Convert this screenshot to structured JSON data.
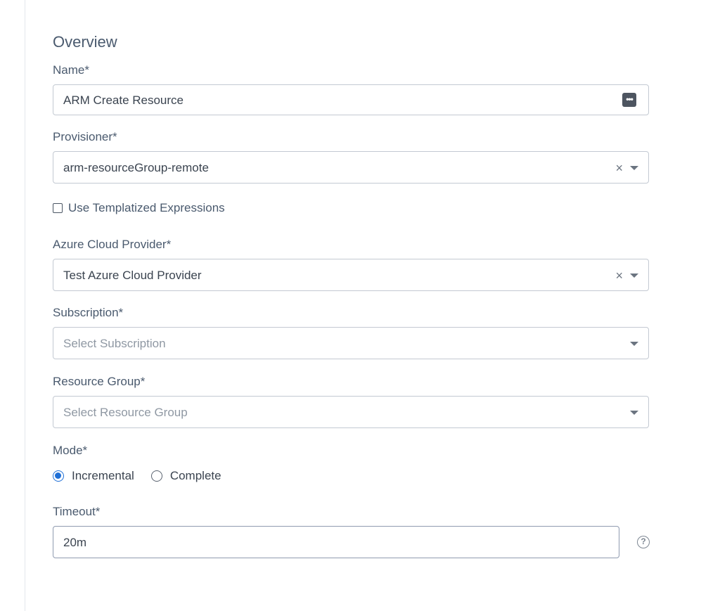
{
  "section": {
    "title": "Overview"
  },
  "name": {
    "label": "Name*",
    "value": "ARM Create Resource",
    "variables_icon": "more-horizontal-icon"
  },
  "provisioner": {
    "label": "Provisioner*",
    "value": "arm-resourceGroup-remote",
    "clear_glyph": "×"
  },
  "templatized": {
    "label": "Use Templatized Expressions",
    "checked": false
  },
  "cloud_provider": {
    "label": "Azure Cloud Provider*",
    "value": "Test Azure Cloud Provider",
    "clear_glyph": "×"
  },
  "subscription": {
    "label": "Subscription*",
    "placeholder": "Select Subscription"
  },
  "resource_group": {
    "label": "Resource Group*",
    "placeholder": "Select Resource Group"
  },
  "mode": {
    "label": "Mode*",
    "options": [
      {
        "label": "Incremental",
        "selected": true
      },
      {
        "label": "Complete",
        "selected": false
      }
    ]
  },
  "timeout": {
    "label": "Timeout*",
    "value": "20m",
    "help_glyph": "?"
  },
  "colors": {
    "accent": "#1f6fd6",
    "label_text": "#4a5a6e",
    "border": "#c3c9d2"
  }
}
